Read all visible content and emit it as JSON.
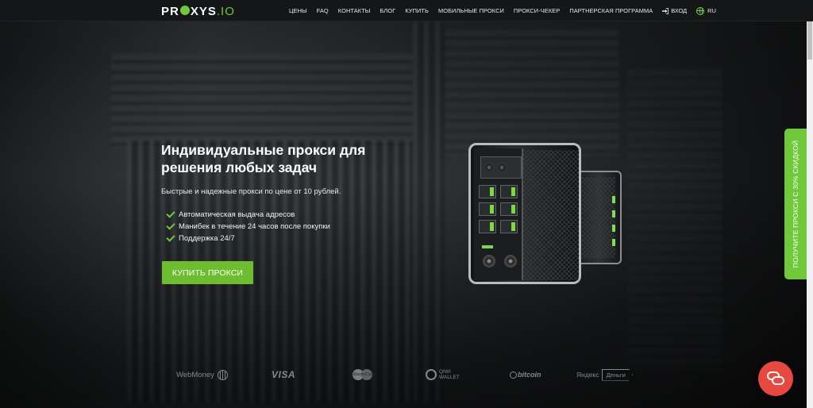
{
  "header": {
    "logo_main": "PR",
    "logo_mid": "XY",
    "logo_s": "S",
    "logo_suffix": ".IO",
    "nav": [
      "ЦЕНЫ",
      "FAQ",
      "КОНТАКТЫ",
      "БЛОГ",
      "КУПИТЬ",
      "МОБИЛЬНЫЕ ПРОКСИ",
      "ПРОКСИ-ЧЕКЕР",
      "ПАРТНЕРСКАЯ ПРОГРАММА"
    ],
    "login_label": "ВХОД",
    "login_icon": "sign-in-icon",
    "lang_label": "RU",
    "lang_icon": "globe-icon"
  },
  "hero": {
    "title": "Индивидуальные прокси для решения любых задач",
    "subtitle": "Быстрые и надежные прокси по цене от 10 рублей.",
    "features": [
      "Автоматическая выдача адресов",
      "Манибек в течение 24 часов после покупки",
      "Поддержка 24/7"
    ],
    "cta_label": "КУПИТЬ ПРОКСИ"
  },
  "payments": {
    "webmoney": "WebMoney",
    "visa": "VISA",
    "mastercard": "MasterCard",
    "qiwi_line1": "QIWI",
    "qiwi_line2": "WALLET",
    "bitcoin": "bitcoin",
    "yandex": "Яндекс",
    "yandex_box": "Деньги"
  },
  "side_tab": {
    "label": "ПОЛУЧИТЕ ПРОКСИ С 30% СКИДКОЙ"
  },
  "chat": {
    "icon": "chat-bubbles-icon"
  },
  "colors": {
    "accent": "#6fc93a",
    "button": "#6cbe2e",
    "chat": "#e8483d",
    "header_bg": "#141618"
  }
}
